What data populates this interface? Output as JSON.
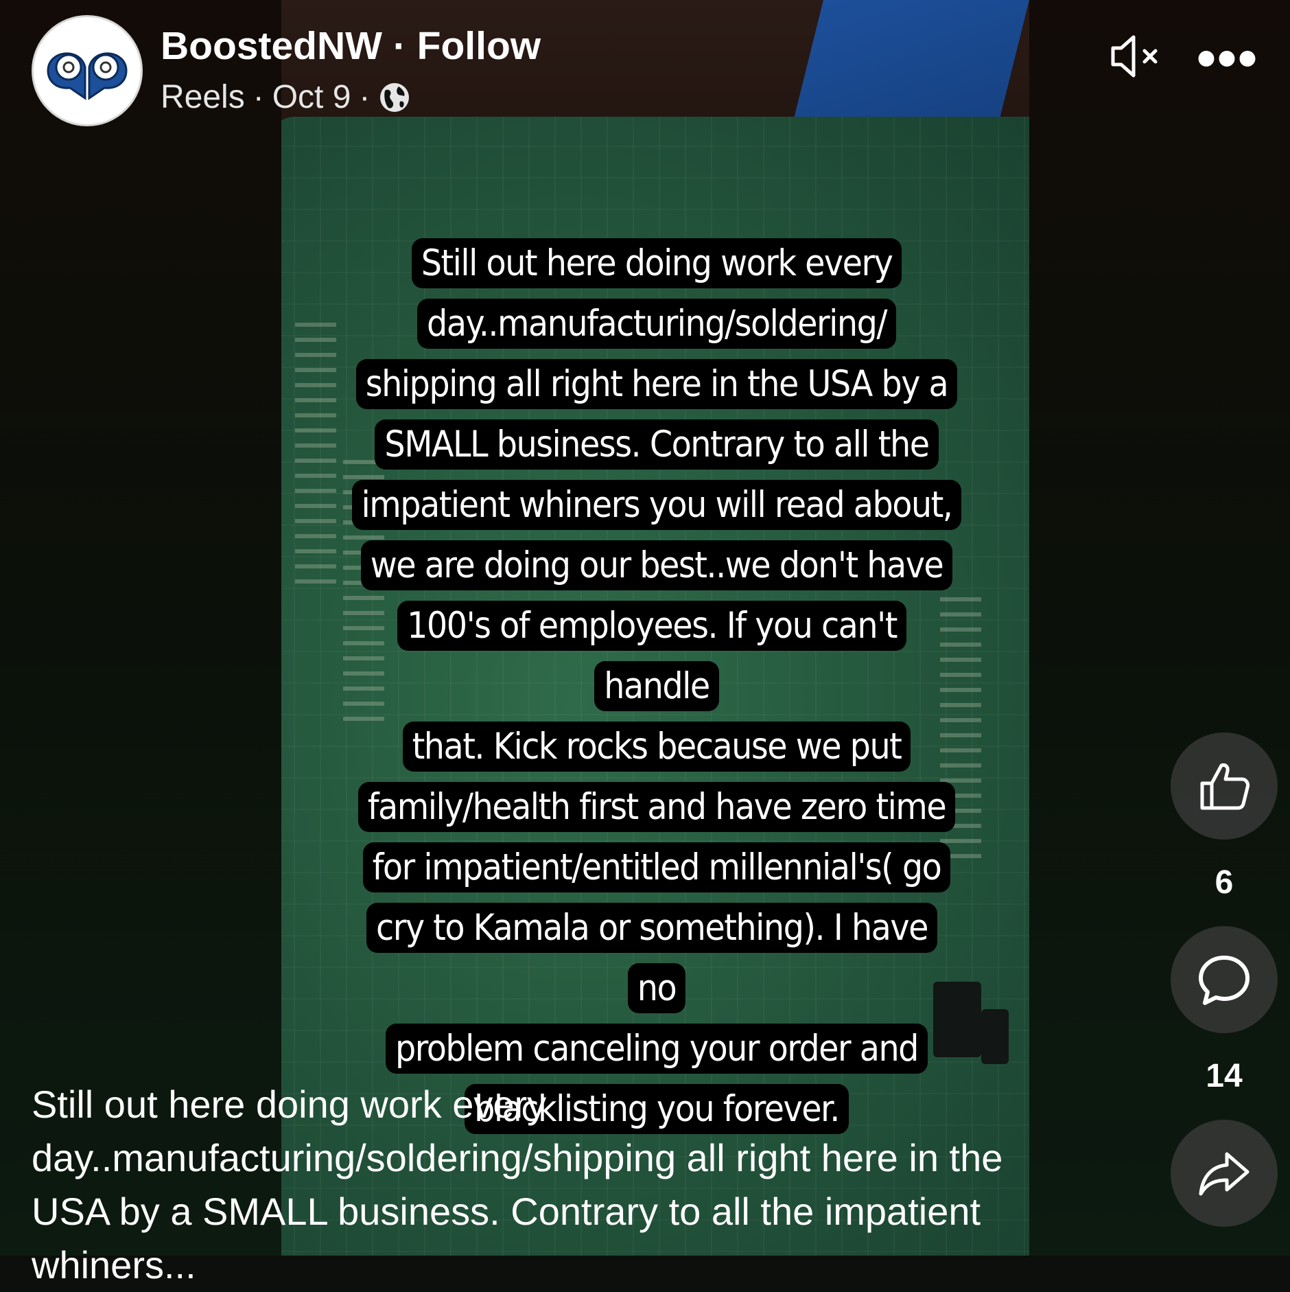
{
  "header": {
    "page_name": "BoostedNW",
    "separator": "·",
    "follow_label": "Follow",
    "meta_type": "Reels",
    "meta_date": "Oct 9",
    "avatar_icon": "turbo-logo-icon",
    "privacy_icon": "globe-icon"
  },
  "controls": {
    "mute_icon": "speaker-muted-icon",
    "more_icon": "more-options-icon",
    "more_label": "•••"
  },
  "overlay": {
    "lines": [
      "Still out here doing work every",
      "day..manufacturing/soldering/",
      "shipping all right here in the USA by a",
      "SMALL business. Contrary to all the",
      "impatient whiners you will read about,",
      "we are doing our best..we don't have",
      "100's of employees. If you can't handle",
      "that. Kick rocks because we put",
      "family/health first and have zero time",
      "for impatient/entitled millennial's( go",
      "cry to Kamala or something). I have no",
      "problem canceling your order and",
      "blacklisting you forever."
    ]
  },
  "actions": {
    "like_icon": "thumbs-up-icon",
    "like_count": "6",
    "comment_icon": "comment-icon",
    "comment_count": "14",
    "share_icon": "share-icon"
  },
  "caption": {
    "text": "Still out here doing work every day..manufacturing/soldering/shipping all right here in the USA by a SMALL business. Contrary to all the impatient whiners..."
  }
}
